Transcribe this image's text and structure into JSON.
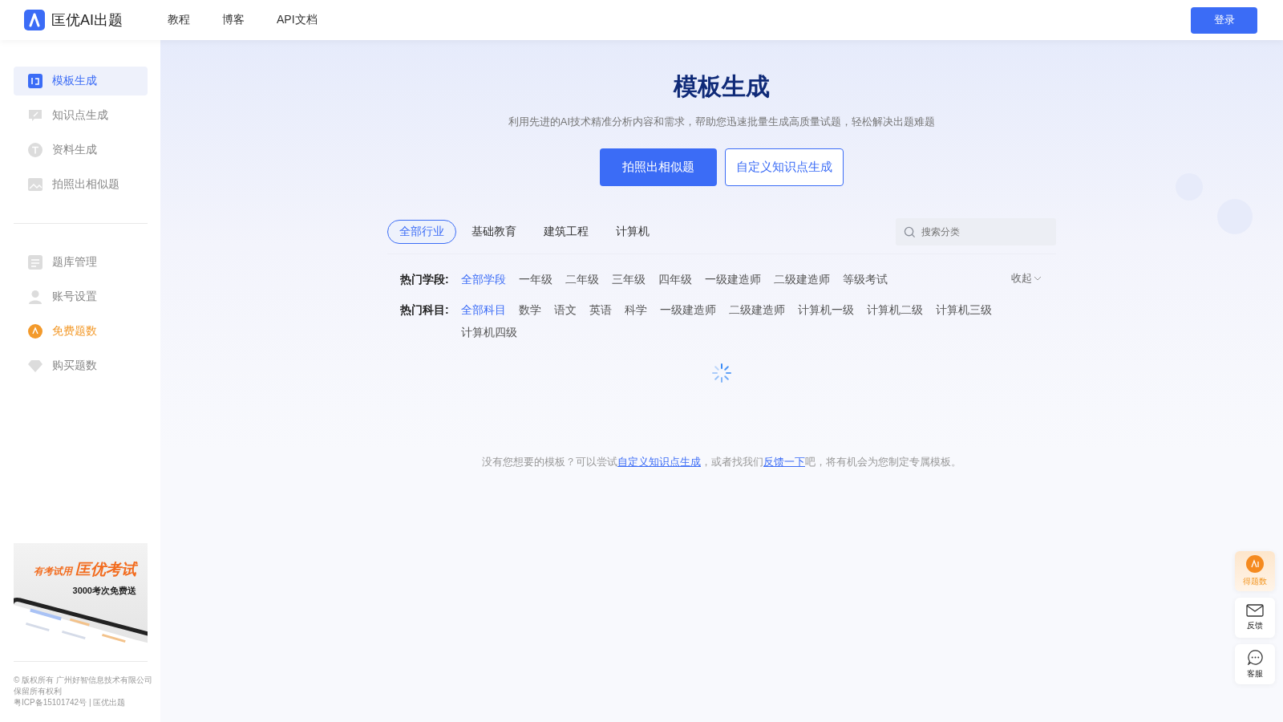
{
  "header": {
    "logo_text": "匡优AI出题",
    "nav": [
      "教程",
      "博客",
      "API文档"
    ],
    "login_button": "登录"
  },
  "sidebar": {
    "groups": [
      {
        "items": [
          {
            "label": "模板生成",
            "selected": true,
            "kind": "nav"
          },
          {
            "label": "知识点生成",
            "selected": false,
            "kind": "nav"
          },
          {
            "label": "资料生成",
            "selected": false,
            "kind": "nav"
          },
          {
            "label": "拍照出相似题",
            "selected": false,
            "kind": "nav"
          }
        ]
      },
      {
        "items": [
          {
            "label": "题库管理",
            "selected": false,
            "kind": "nav"
          },
          {
            "label": "账号设置",
            "selected": false,
            "kind": "nav"
          },
          {
            "label": "免费题数",
            "selected": false,
            "kind": "promo"
          },
          {
            "label": "购买题数",
            "selected": false,
            "kind": "nav"
          }
        ]
      }
    ],
    "banner": {
      "slogan_small": "有考试用",
      "slogan_big": "匡优考试",
      "offer": "3000考次免费送"
    },
    "copyright": [
      "© 版权所有 广州好智信息技术有限公司",
      "保留所有权利",
      "粤ICP备15101742号 | 匡优出题"
    ]
  },
  "hero": {
    "title": "模板生成",
    "subtitle": "利用先进的AI技术精准分析内容和需求，帮助您迅速批量生成高质量试题，轻松解决出题难题",
    "buttons": [
      {
        "label": "拍照出相似题",
        "kind": "primary"
      },
      {
        "label": "自定义知识点生成",
        "kind": "outline"
      }
    ]
  },
  "industry_tabs": [
    {
      "label": "全部行业",
      "selected": true
    },
    {
      "label": "基础教育",
      "selected": false
    },
    {
      "label": "建筑工程",
      "selected": false
    },
    {
      "label": "计算机",
      "selected": false
    }
  ],
  "search": {
    "placeholder": "搜索分类"
  },
  "filters": [
    {
      "label": "热门学段:",
      "options": [
        {
          "label": "全部学段",
          "selected": true
        },
        {
          "label": "一年级",
          "selected": false
        },
        {
          "label": "二年级",
          "selected": false
        },
        {
          "label": "三年级",
          "selected": false
        },
        {
          "label": "四年级",
          "selected": false
        },
        {
          "label": "一级建造师",
          "selected": false
        },
        {
          "label": "二级建造师",
          "selected": false
        },
        {
          "label": "等级考试",
          "selected": false
        }
      ],
      "toggle": "收起"
    },
    {
      "label": "热门科目:",
      "options": [
        {
          "label": "全部科目",
          "selected": true
        },
        {
          "label": "数学",
          "selected": false
        },
        {
          "label": "语文",
          "selected": false
        },
        {
          "label": "英语",
          "selected": false
        },
        {
          "label": "科学",
          "selected": false
        },
        {
          "label": "一级建造师",
          "selected": false
        },
        {
          "label": "二级建造师",
          "selected": false
        },
        {
          "label": "计算机一级",
          "selected": false
        },
        {
          "label": "计算机二级",
          "selected": false
        },
        {
          "label": "计算机三级",
          "selected": false
        },
        {
          "label": "计算机四级",
          "selected": false
        }
      ]
    }
  ],
  "empty_hint": [
    {
      "text": "没有您想要的模板？可以尝试",
      "kind": "text"
    },
    {
      "text": "自定义知识点生成",
      "kind": "link"
    },
    {
      "text": "，或者找我们",
      "kind": "text"
    },
    {
      "text": "反馈一下",
      "kind": "link"
    },
    {
      "text": "吧，将有机会为您制定专属模板。",
      "kind": "text"
    }
  ],
  "float_buttons": [
    {
      "label": "得题数",
      "kind": "ai"
    },
    {
      "label": "反馈",
      "kind": "mail"
    },
    {
      "label": "客服",
      "kind": "chat"
    }
  ]
}
